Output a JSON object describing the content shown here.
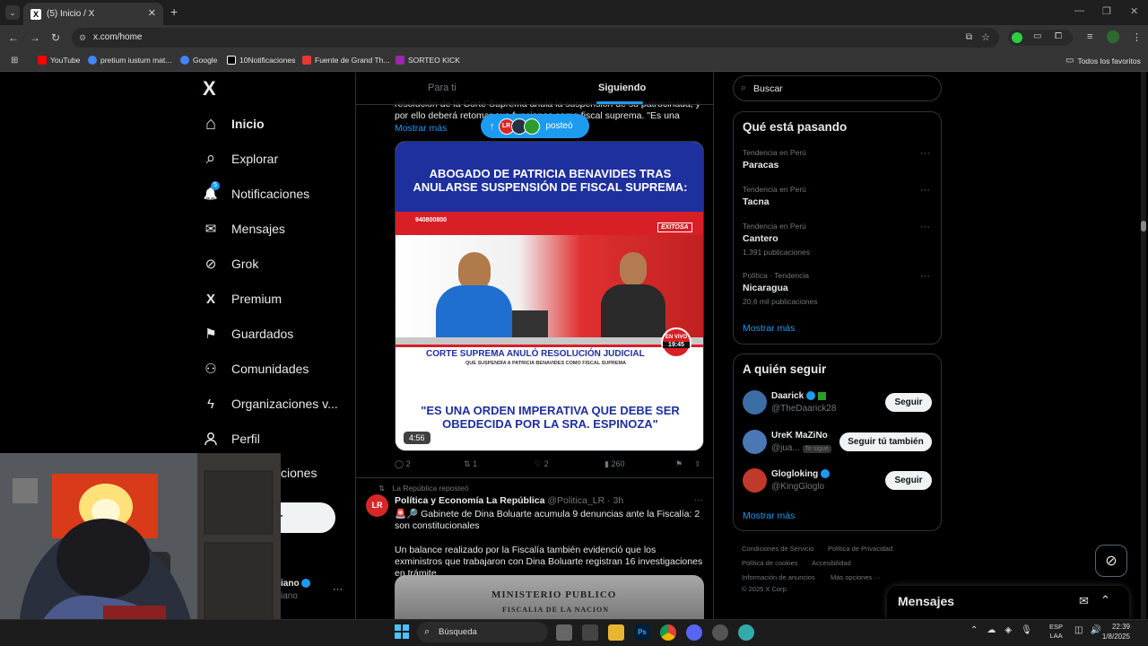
{
  "browser": {
    "tab_title": "(5) Inicio / X",
    "tab_close": "✕",
    "new_tab": "+",
    "url": "x.com/home",
    "bookmarks": [
      {
        "label": "YouTube",
        "color": "#ff0000"
      },
      {
        "label": "pretium iustum mat...",
        "color": "#4285f4"
      },
      {
        "label": "Google",
        "color": "#4285f4"
      },
      {
        "label": "10Notificaciones",
        "color": "#ffffff"
      },
      {
        "label": "Fuente de Grand Th...",
        "color": "#e53935"
      },
      {
        "label": "SORTEO KICK",
        "color": "#9c27b0"
      }
    ],
    "all_favorites": "Todos los favoritos"
  },
  "nav": {
    "logo": "X",
    "items": [
      {
        "label": "Inicio",
        "icon": "home-icon",
        "glyph": "⌂"
      },
      {
        "label": "Explorar",
        "icon": "search-icon",
        "glyph": "⌕"
      },
      {
        "label": "Notificaciones",
        "icon": "bell-icon",
        "glyph": "🔔",
        "badge": "5"
      },
      {
        "label": "Mensajes",
        "icon": "envelope-icon",
        "glyph": "✉"
      },
      {
        "label": "Grok",
        "icon": "grok-icon",
        "glyph": "⊘"
      },
      {
        "label": "Premium",
        "icon": "x-premium-icon",
        "glyph": "X"
      },
      {
        "label": "Guardados",
        "icon": "bookmark-icon",
        "glyph": "⚑"
      },
      {
        "label": "Comunidades",
        "icon": "communities-icon",
        "glyph": "⚇"
      },
      {
        "label": "Organizaciones v...",
        "icon": "lightning-icon",
        "glyph": "ϟ"
      },
      {
        "label": "Perfil",
        "icon": "person-icon",
        "glyph": "⚲"
      },
      {
        "label": "ciones",
        "icon": "more-icon",
        "glyph": ""
      }
    ],
    "post_button_partial": "r",
    "account_partial": "iano",
    "account_handle_partial": "iano",
    "account_more": "···"
  },
  "timeline": {
    "tabs": [
      {
        "label": "Para ti"
      },
      {
        "label": "Siguiendo"
      }
    ],
    "post1_text": "resolución de la Corte Suprema anula la suspensión de su patrocinada, y por ello deberá retomar sus funciones como fiscal suprema. \"Es una orden",
    "post1_more": "Mostrar más",
    "new_posts_pill": "posteó",
    "media": {
      "headline": "ABOGADO DE PATRICIA BENAVIDES TRAS ANULARSE SUSPENSIÓN DE FISCAL SUPREMA:",
      "phone": "940800800",
      "channel": "EXITOSA",
      "banner": "CORTE SUPREMA ANULÓ RESOLUCIÓN JUDICIAL",
      "banner_sub": "QUE SUSPENDÍA A PATRICIA BENAVIDES COMO FISCAL SUPREMA",
      "live": "EN VIVO",
      "live_time": "19:45",
      "quote": "\"ES UNA ORDEN IMPERATIVA QUE DEBE SER OBEDECIDA POR LA SRA. ESPINOZA\"",
      "duration": "4:56"
    },
    "post1_actions": {
      "replies": "2",
      "reposts": "1",
      "likes": "2",
      "views": "260"
    },
    "post2": {
      "repost_note": "La República reposteó",
      "author": "Política y Economía La República",
      "handle": "@Politica_LR · 3h",
      "line1": "🚨🔎 Gabinete de Dina Boluarte acumula 9 denuncias ante la Fiscalía: 2 son constitucionales",
      "line2": "Un balance realizado por la Fiscalía también evidenció que los exministros que trabajaron con Dina Boluarte registran 16 investigaciones en trámite.",
      "image_text1": "MINISTERIO PUBLICO",
      "image_text2": "FISCALIA DE LA NACION",
      "more": "···"
    }
  },
  "sidebar": {
    "search_placeholder": "Buscar",
    "trends_title": "Qué está pasando",
    "trends": [
      {
        "category": "Tendencia en Perú",
        "name": "Paracas",
        "count": ""
      },
      {
        "category": "Tendencia en Perú",
        "name": "Tacna",
        "count": ""
      },
      {
        "category": "Tendencia en Perú",
        "name": "Cantero",
        "count": "1.391 publicaciones"
      },
      {
        "category": "Política · Tendencia",
        "name": "Nicaragua",
        "count": "20,6 mil publicaciones"
      }
    ],
    "trends_more": "Mostrar más",
    "follow_title": "A quién seguir",
    "follow": [
      {
        "name": "Daarick",
        "handle": "@TheDaarick28",
        "button": "Seguir",
        "avatar_color": "#3a6ea5"
      },
      {
        "name": "UreK MaZiNo",
        "handle": "@jua...",
        "follows_you": "Te sigue",
        "button": "Seguir tú también",
        "avatar_color": "#4a78b5"
      },
      {
        "name": "Glogloking",
        "handle": "@KingGloglo",
        "button": "Seguir",
        "avatar_color": "#c0392b"
      }
    ],
    "follow_more": "Mostrar más",
    "footer": {
      "terms": "Condiciones de Servicio",
      "privacy": "Política de Privacidad",
      "cookies": "Política de cookies",
      "accessibility": "Accesibilidad",
      "ads": "Información de anuncios",
      "more": "Más opciones ···",
      "copyright": "© 2025 X Corp."
    },
    "messages_title": "Mensajes"
  },
  "taskbar": {
    "search_label": "Búsqueda",
    "lang1": "ESP",
    "lang2": "LAA",
    "time": "22:39",
    "date": "1/8/2025"
  }
}
